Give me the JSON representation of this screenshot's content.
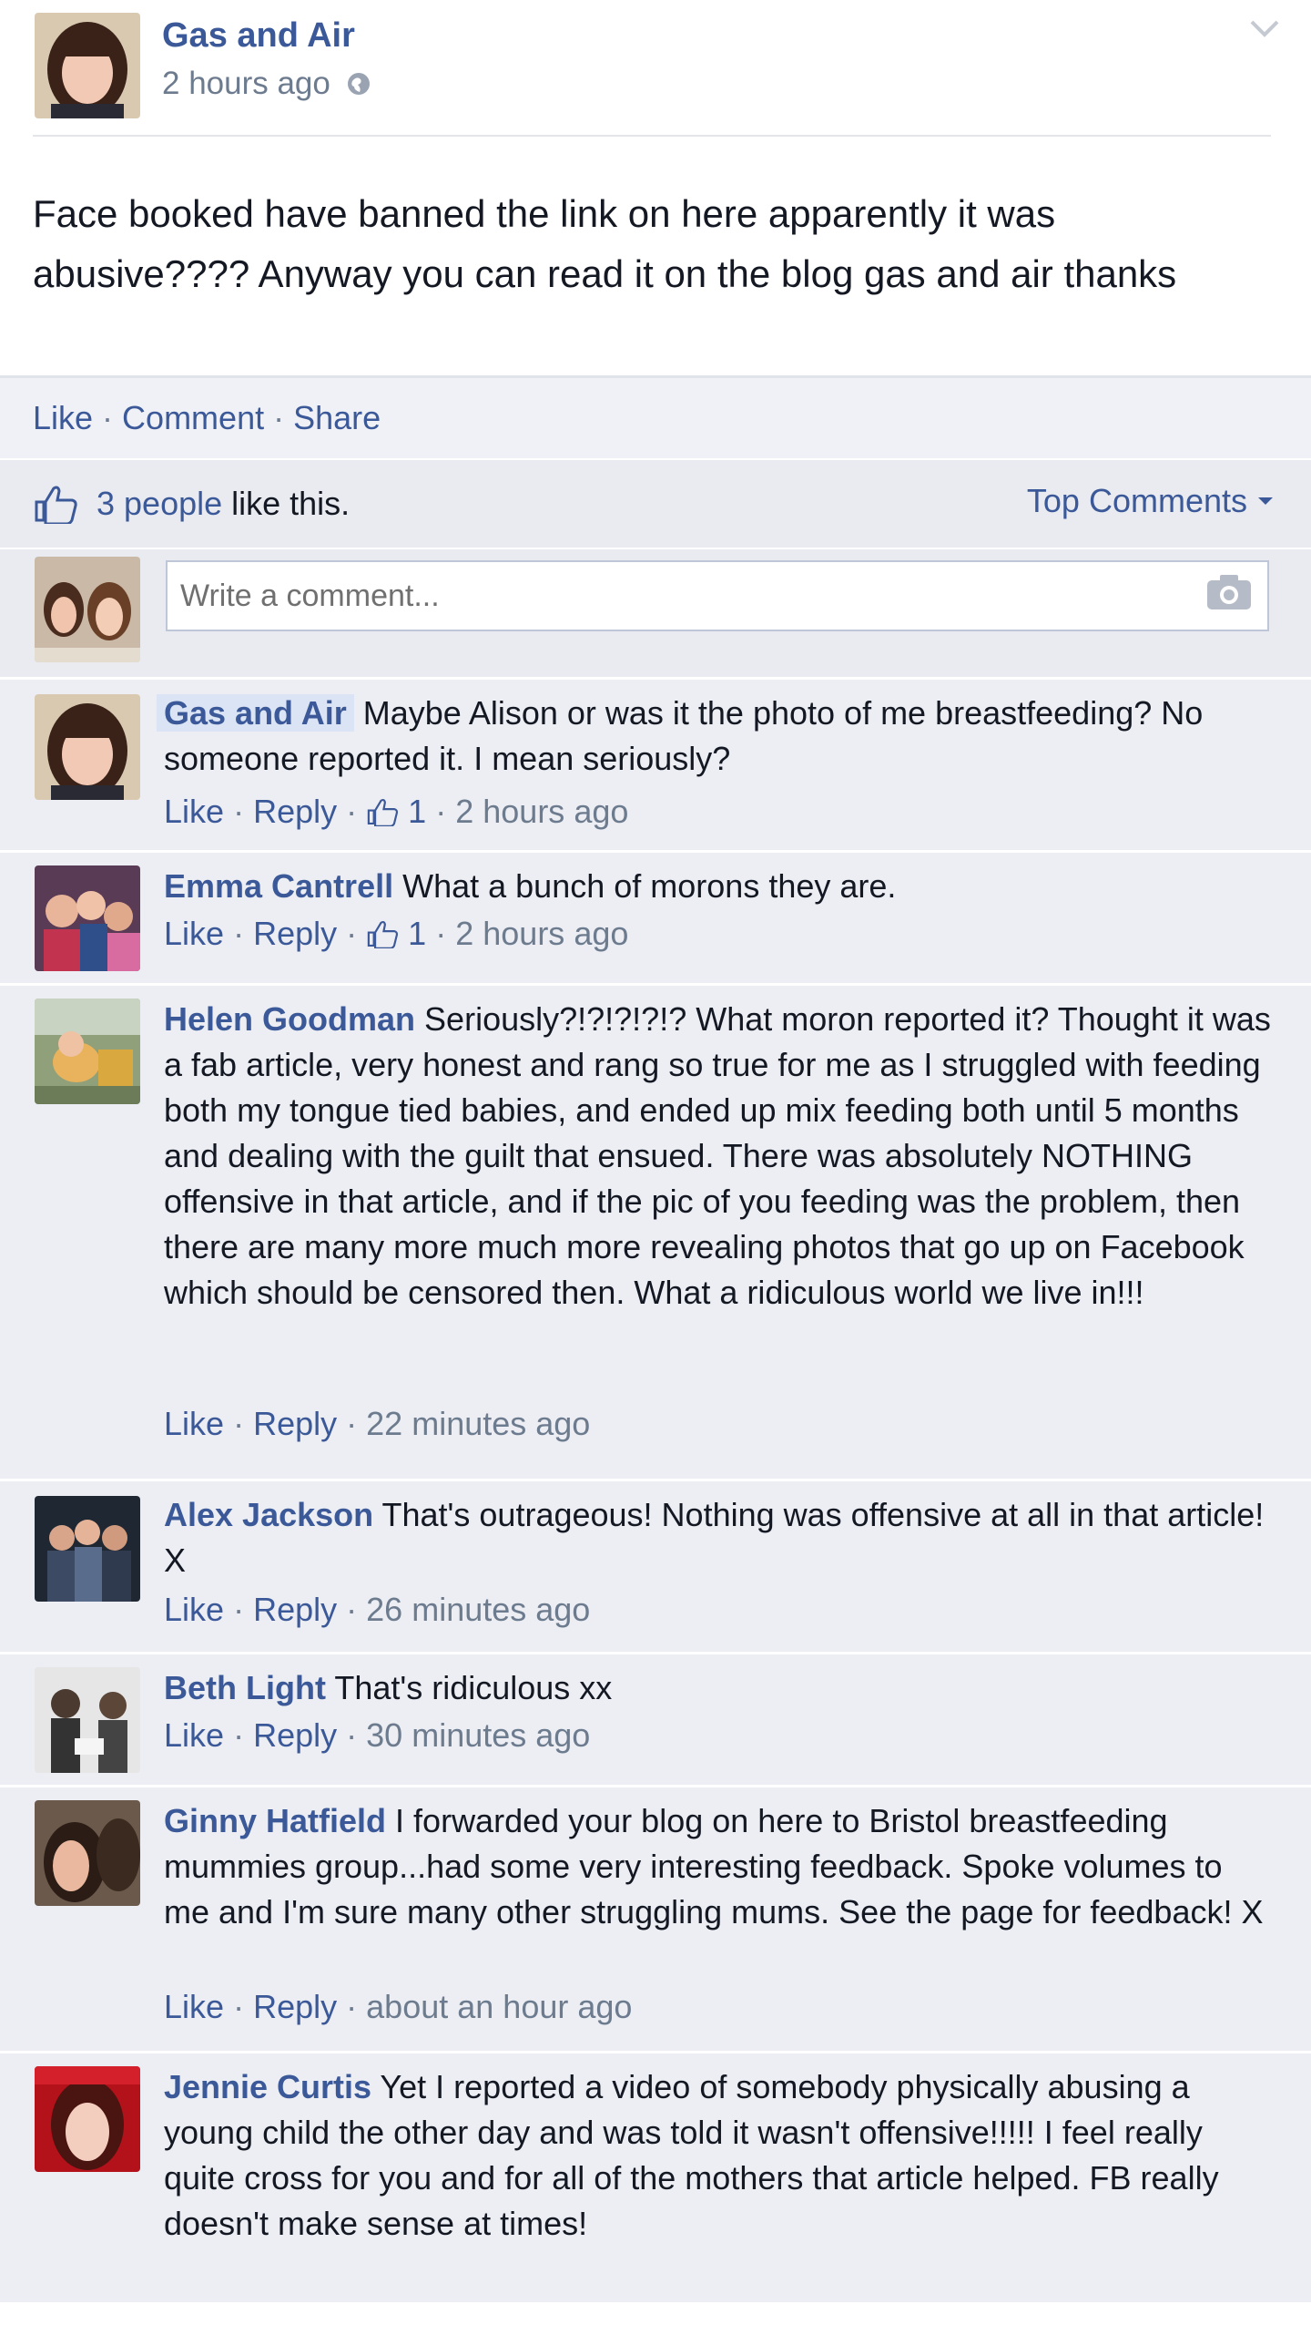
{
  "post": {
    "author": "Gas and Air",
    "time": "2 hours ago",
    "text": "Face booked have banned the link on here apparently it was abusive???? Anyway you can read it on the blog gas and air thanks"
  },
  "actions": {
    "like": "Like",
    "comment": "Comment",
    "share": "Share",
    "sep": "·"
  },
  "likes": {
    "count": "3 people",
    "text": "like this.",
    "sort_label": "Top Comments"
  },
  "comment_box": {
    "placeholder": "Write a comment..."
  },
  "meta_labels": {
    "like": "Like",
    "reply": "Reply",
    "sep": "·"
  },
  "comments": [
    {
      "author": "Gas and Air",
      "text": "Maybe Alison or was it the photo of me breastfeeding? No someone reported it. I mean seriously?",
      "likes": "1",
      "time": "2 hours ago"
    },
    {
      "author": "Emma Cantrell",
      "text": "What a bunch of morons they are.",
      "likes": "1",
      "time": "2 hours ago"
    },
    {
      "author": "Helen Goodman",
      "text": "Seriously?!?!?!?!? What moron reported it? Thought it was a fab article, very honest and rang so true for me as I struggled with feeding both my tongue tied babies, and ended up mix feeding both until 5 months and dealing with the guilt that ensued. There was absolutely NOTHING offensive in that article, and if the pic of you feeding was the problem, then there are many more much more revealing photos that go up on Facebook which should be censored then. What a ridiculous world we live in!!!",
      "time": "22 minutes ago"
    },
    {
      "author": "Alex Jackson",
      "text": "That's outrageous! Nothing was offensive at all in that article! X",
      "time": "26 minutes ago"
    },
    {
      "author": "Beth Light",
      "text": "That's ridiculous xx",
      "time": "30 minutes ago"
    },
    {
      "author": "Ginny Hatfield",
      "text": "I forwarded your blog on here to Bristol breastfeeding mummies group...had some very interesting feedback. Spoke volumes to me and I'm sure many other struggling mums. See the page for feedback! X",
      "time": "about an hour ago"
    },
    {
      "author": "Jennie Curtis",
      "text": "Yet I reported a video of somebody physically abusing a young child the other day and was told it wasn't offensive!!!!! I feel really quite cross for you and for all of the mothers that article helped. FB really doesn't make sense at times!"
    }
  ]
}
